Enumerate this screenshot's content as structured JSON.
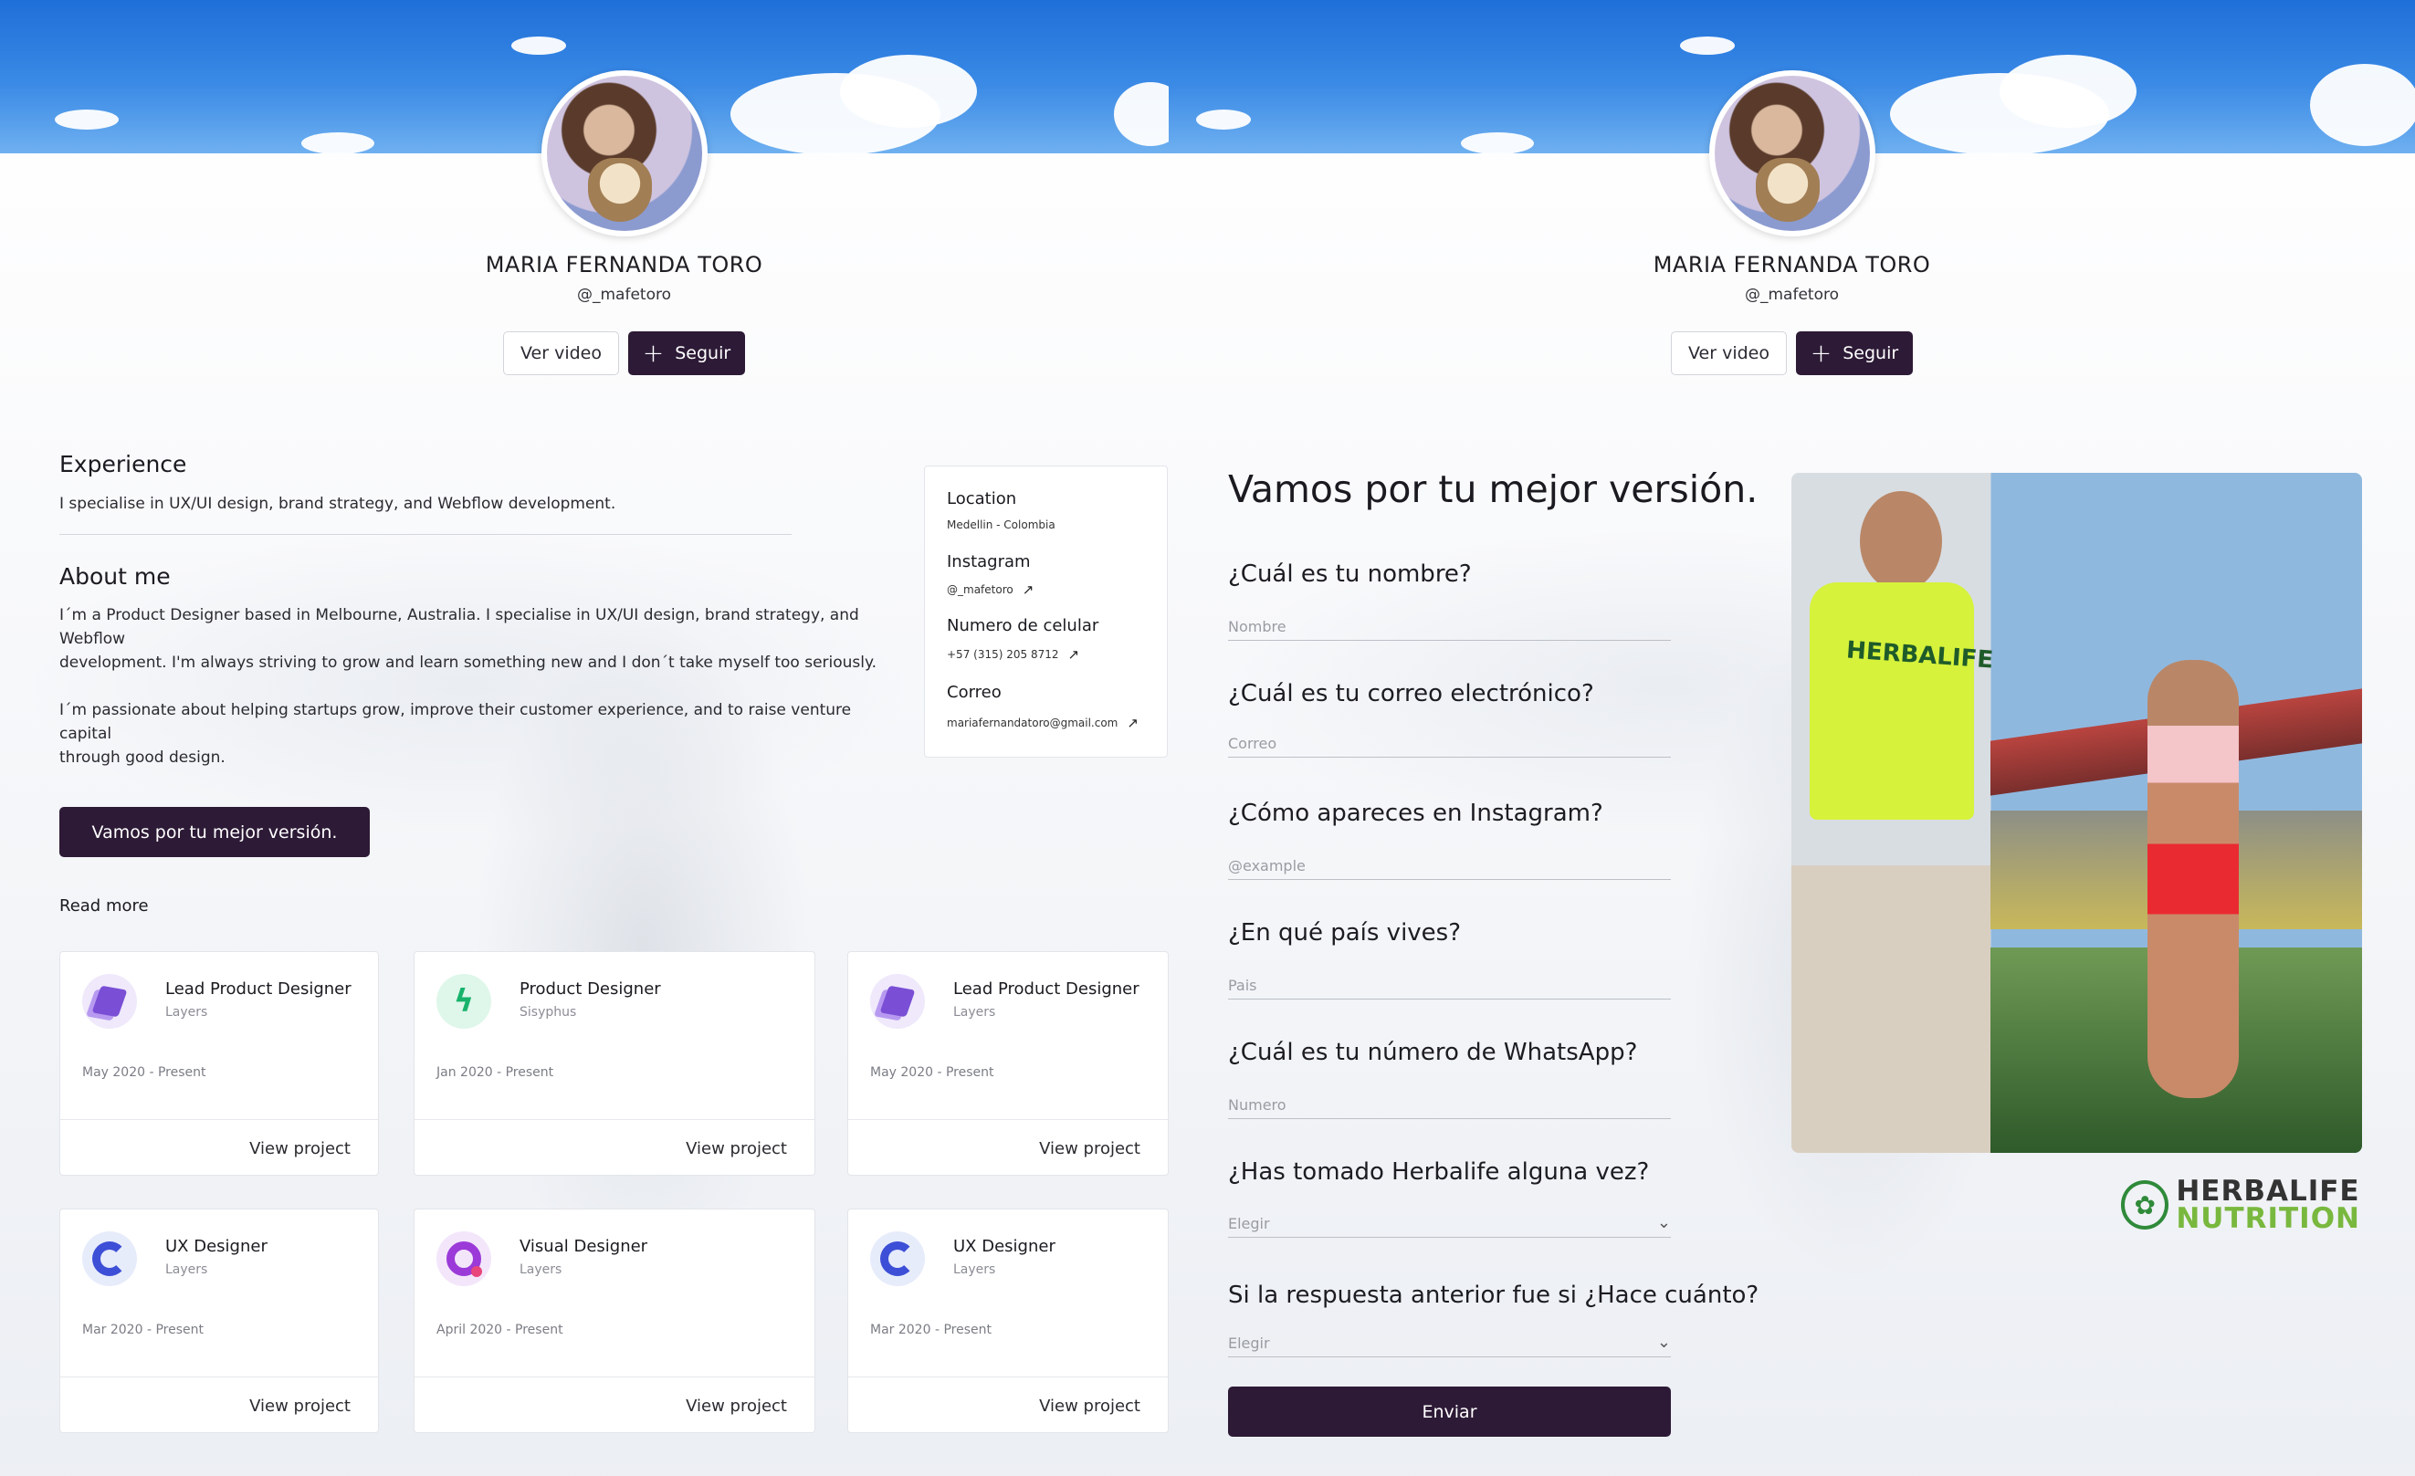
{
  "profile": {
    "name": "MARIA FERNANDA TORO",
    "handle": "@_mafetoro",
    "ver_video": "Ver video",
    "seguir": "Seguir"
  },
  "experience": {
    "title": "Experience",
    "text": "I specialise in UX/UI design, brand strategy, and Webflow development."
  },
  "about": {
    "title": "About me",
    "line1": "I´m a Product Designer based in Melbourne, Australia. I specialise in UX/UI design, brand strategy, and",
    "line2": "Webflow",
    "line3": "development. I'm always striving to grow and learn something new and I don´t take myself too seriously.",
    "line4": "I´m passionate about helping startups grow, improve their customer experience, and to raise venture",
    "line5": "capital",
    "line6": "through good design."
  },
  "cta_label": "Vamos por tu mejor versión.",
  "read_more": "Read more",
  "info": {
    "location_label": "Location",
    "location_value": "Medellin - Colombia",
    "instagram_label": "Instagram",
    "instagram_value": "@_mafetoro",
    "phone_label": "Numero de celular",
    "phone_value": "+57 (315) 205 8712",
    "email_label": "Correo",
    "email_value": "mariafernandatoro@gmail.com"
  },
  "projects": [
    {
      "title": "Lead Product Designer",
      "company": "Layers",
      "dates": "May 2020 - Present",
      "link": "View project",
      "icon": "layers-icon"
    },
    {
      "title": "Product Designer",
      "company": "Sisyphus",
      "dates": "Jan 2020 - Present",
      "link": "View project",
      "icon": "bolt-icon"
    },
    {
      "title": "Lead Product Designer",
      "company": "Layers",
      "dates": "May 2020 - Present",
      "link": "View project",
      "icon": "layers-icon"
    },
    {
      "title": "UX Designer",
      "company": "Layers",
      "dates": "Mar 2020 - Present",
      "link": "View project",
      "icon": "c-logo-icon"
    },
    {
      "title": "Visual Designer",
      "company": "Layers",
      "dates": "April 2020 - Present",
      "link": "View project",
      "icon": "q-logo-icon"
    },
    {
      "title": "UX Designer",
      "company": "Layers",
      "dates": "Mar 2020 - Present",
      "link": "View project",
      "icon": "c-logo-icon"
    }
  ],
  "form": {
    "title": "Vamos por tu mejor versión.",
    "q_name": "¿Cuál es tu nombre?",
    "ph_name": "Nombre",
    "q_email": "¿Cuál es tu correo electrónico?",
    "ph_email": "Correo",
    "q_instagram": "¿Cómo apareces en Instagram?",
    "ph_instagram": "@example",
    "q_country": "¿En qué país vives?",
    "ph_country": "Pais",
    "q_whatsapp": "¿Cuál es tu número de WhatsApp?",
    "ph_whatsapp": "Numero",
    "q_herbalife": "¿Has tomado Herbalife alguna vez?",
    "sel_herbalife": "Elegir",
    "q_when": "Si la respuesta anterior fue si ¿Hace cuánto?",
    "sel_when": "Elegir",
    "submit": "Enviar"
  },
  "photo_shirt_text": "HERBALIFE",
  "logo": {
    "line1": "HERBALIFE",
    "line2": "NUTRITION"
  },
  "colors": {
    "primary_dark": "#2d1a36",
    "sky": "#3a8ae6",
    "logo_green": "#79b83e"
  }
}
